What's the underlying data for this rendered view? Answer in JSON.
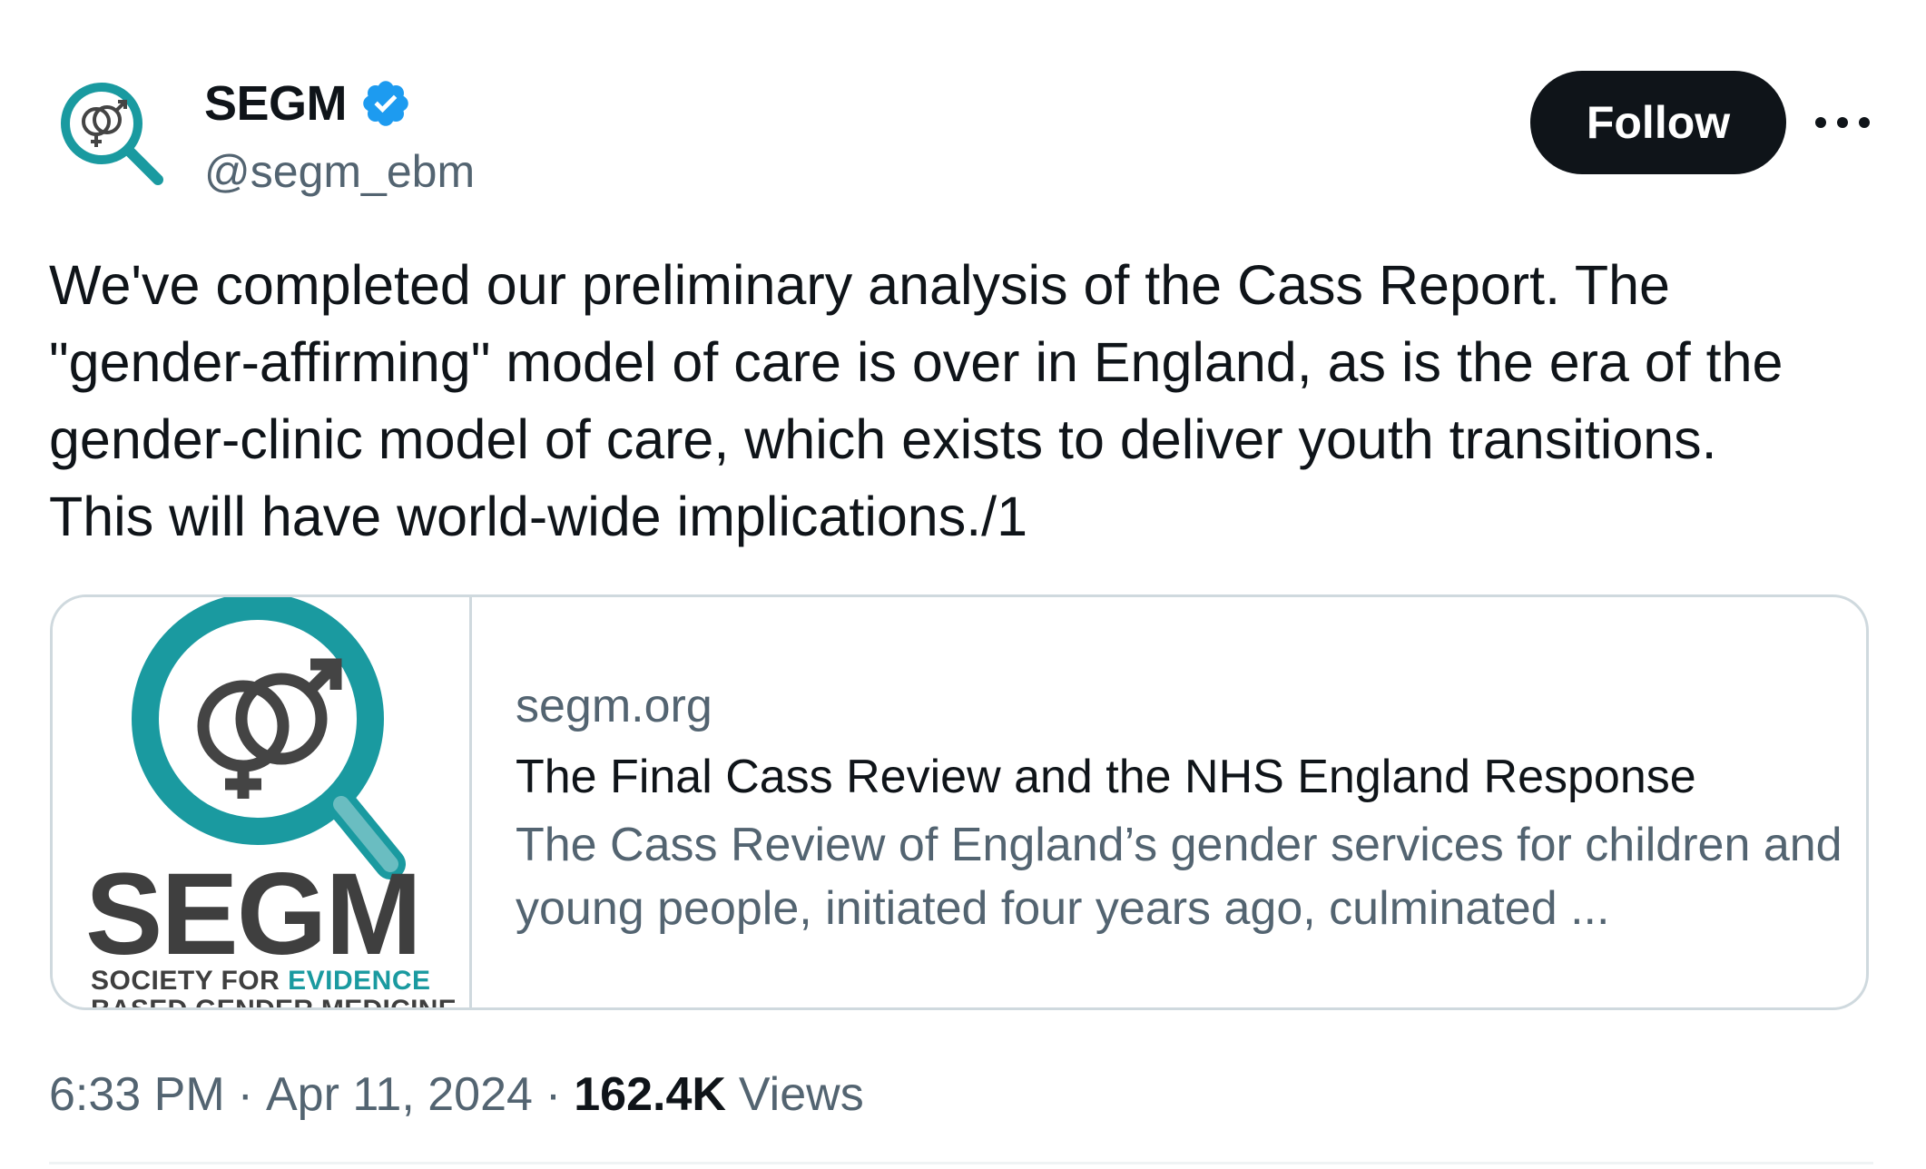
{
  "author": {
    "display_name": "SEGM",
    "handle": "@segm_ebm",
    "verified": true
  },
  "actions": {
    "follow_label": "Follow"
  },
  "tweet": {
    "text": "We've completed our preliminary analysis of the Cass Report. The\n\"gender-affirming\" model of care is over in England, as is the era of the\ngender-clinic model of care, which exists to deliver youth transitions.\nThis will have world-wide implications./1"
  },
  "card": {
    "logo": {
      "wordmark": "SEGM",
      "tagline_part1": "SOCIETY FOR ",
      "tagline_accent": "EVIDENCE",
      "tagline_line2": "BASED GENDER MEDICINE"
    },
    "domain": "segm.org",
    "title": "The Final Cass Review and the NHS England Response",
    "description": "The Cass Review of England’s gender services for children and young people, initiated four years ago, culminated ..."
  },
  "meta": {
    "time": "6:33 PM",
    "separator": "·",
    "date": "Apr 11, 2024",
    "views_count": "162.4K",
    "views_label": "Views"
  },
  "colors": {
    "brand_teal": "#1a9aa0",
    "verified_blue": "#1d9bf0",
    "text_primary": "#0f1419",
    "text_secondary": "#536471",
    "border": "#cfd9de"
  },
  "icons": {
    "verified": "verified-badge-icon",
    "more": "more-horizontal-icon",
    "avatar_logo": "magnifier-gender-symbols-icon"
  }
}
